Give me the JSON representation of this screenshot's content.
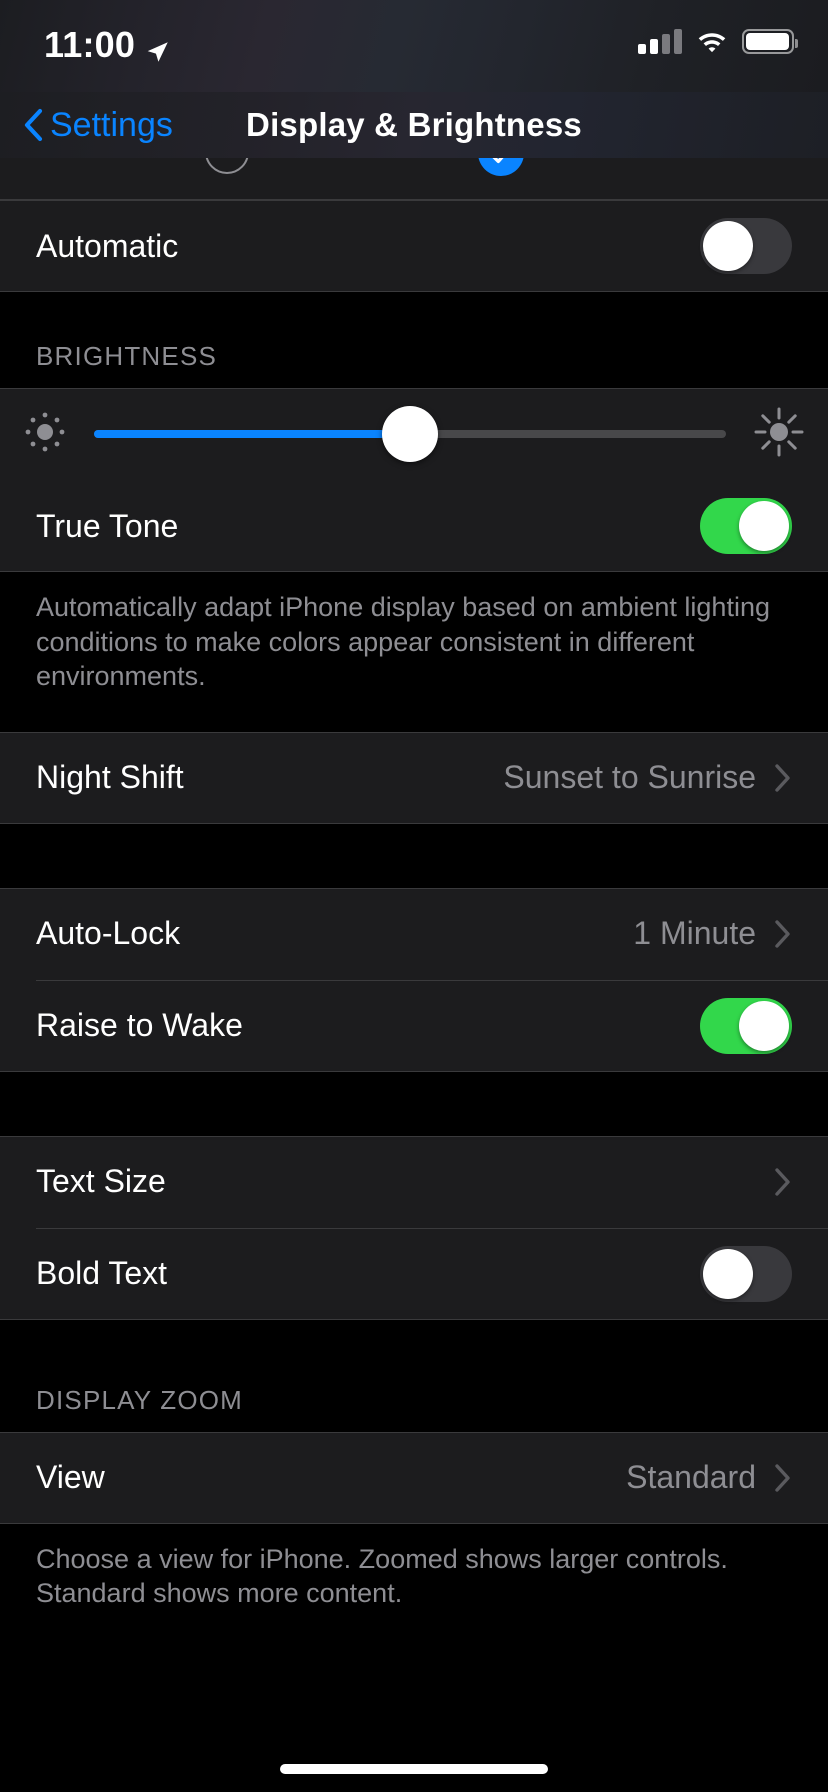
{
  "status_bar": {
    "time": "11:00",
    "location_icon": "location-arrow-icon",
    "cellular_icon": "cellular-signal-icon",
    "cellular_bars_filled": 2,
    "cellular_bars_total": 4,
    "wifi_icon": "wifi-icon",
    "battery_icon": "battery-icon",
    "battery_level_percent": 92
  },
  "nav": {
    "back_label": "Settings",
    "back_icon": "chevron-left-icon",
    "title": "Display & Brightness"
  },
  "appearance": {
    "light_option_icon": "radio-unselected-icon",
    "dark_option_icon": "radio-selected-checkmark-icon",
    "selected": "Dark"
  },
  "automatic": {
    "label": "Automatic",
    "toggle_state": "off"
  },
  "brightness": {
    "header": "BRIGHTNESS",
    "low_icon": "brightness-low-sun-icon",
    "high_icon": "brightness-high-sun-icon",
    "value_percent": 50,
    "true_tone": {
      "label": "True Tone",
      "toggle_state": "on"
    },
    "footnote": "Automatically adapt iPhone display based on ambient lighting conditions to make colors appear consistent in different environments."
  },
  "night_shift": {
    "label": "Night Shift",
    "value": "Sunset to Sunrise",
    "chevron_icon": "chevron-right-icon"
  },
  "lock": {
    "auto_lock": {
      "label": "Auto-Lock",
      "value": "1 Minute",
      "chevron_icon": "chevron-right-icon"
    },
    "raise_to_wake": {
      "label": "Raise to Wake",
      "toggle_state": "on"
    }
  },
  "text": {
    "text_size": {
      "label": "Text Size",
      "chevron_icon": "chevron-right-icon"
    },
    "bold_text": {
      "label": "Bold Text",
      "toggle_state": "off"
    }
  },
  "display_zoom": {
    "header": "DISPLAY ZOOM",
    "view": {
      "label": "View",
      "value": "Standard",
      "chevron_icon": "chevron-right-icon"
    },
    "footnote": "Choose a view for iPhone. Zoomed shows larger controls. Standard shows more content."
  },
  "colors": {
    "accent_blue": "#0a84ff",
    "toggle_on_green": "#32d74b",
    "toggle_off_gray": "#39393d",
    "row_background": "#1c1c1e",
    "page_background": "#000000",
    "secondary_text": "#8e8e93",
    "separator": "#3a3a3c"
  }
}
